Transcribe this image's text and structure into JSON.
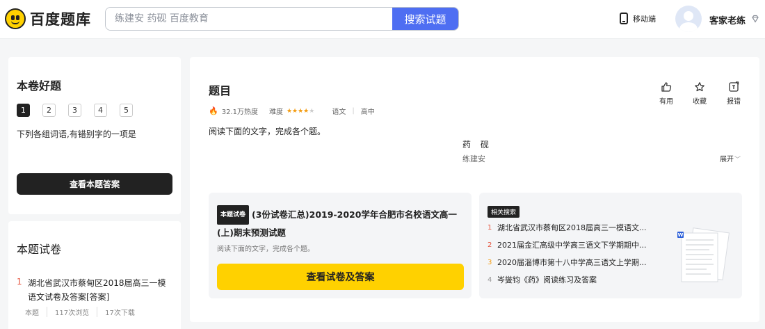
{
  "header": {
    "logo_text": "百度题库",
    "search_placeholder": "练建安 药砚 百度教育",
    "search_button": "搜索试题",
    "mobile_label": "移动端",
    "username": "客家老练"
  },
  "sidebar": {
    "title": "本卷好题",
    "question_numbers": [
      "1",
      "2",
      "3",
      "4",
      "5"
    ],
    "question_text": "下列各组词语,有错别字的一项是",
    "answer_button": "查看本题答案",
    "papers_title": "本题试卷",
    "paper_item": {
      "index": "1",
      "title": "湖北省武汉市蔡甸区2018届高三一模语文试卷及答案[答案]",
      "meta": [
        "本题",
        "117次浏览",
        "17次下载"
      ]
    }
  },
  "question": {
    "title": "题目",
    "heat": "32.1万热度",
    "difficulty_label": "难度",
    "difficulty_stars": 4,
    "difficulty_max": 5,
    "subject": "语文",
    "level": "高中",
    "body": "阅读下面的文字，完成各个题。",
    "poem_title": "药 砚",
    "poem_author": "练建安",
    "expand_label": "展开",
    "actions": {
      "useful": "有用",
      "favorite": "收藏",
      "report": "报错"
    }
  },
  "paper_card": {
    "tag": "本题试卷",
    "title": "(3份试卷汇总)2019-2020学年合肥市名校语文高一(上)期末预测试题",
    "desc": "阅读下面的文字，完成各个题。",
    "button": "查看试卷及答案"
  },
  "related": {
    "tag": "相关搜索",
    "items": [
      {
        "n": "1",
        "text": "湖北省武汉市蔡甸区2018届高三一模语文..."
      },
      {
        "n": "2",
        "text": "2021届金汇高级中学高三语文下学期期中..."
      },
      {
        "n": "3",
        "text": "2020届淄博市第十八中学高三语文上学期..."
      },
      {
        "n": "4",
        "text": "岑燮钧《药》阅读练习及答案"
      }
    ]
  },
  "colors": {
    "brand_yellow": "#ffd100",
    "search_blue": "#4e6ef2",
    "rank_red": "#e5533d",
    "rank_orange": "#f39c12"
  }
}
